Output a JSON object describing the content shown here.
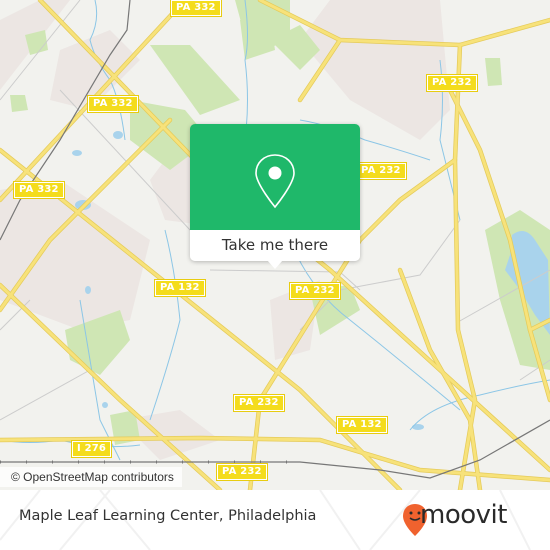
{
  "map": {
    "attribution": "© OpenStreetMap contributors",
    "road_shields": [
      {
        "id": "pa332-top",
        "label": "PA 332"
      },
      {
        "id": "pa332-mid",
        "label": "PA 332"
      },
      {
        "id": "pa332-left",
        "label": "PA 332"
      },
      {
        "id": "pa232-ne",
        "label": "PA 232"
      },
      {
        "id": "pa232-e",
        "label": "PA 232"
      },
      {
        "id": "pa232-center",
        "label": "PA 232"
      },
      {
        "id": "pa132-w",
        "label": "PA 132"
      },
      {
        "id": "pa232-s",
        "label": "PA 232"
      },
      {
        "id": "pa132-se",
        "label": "PA 132"
      },
      {
        "id": "i276",
        "label": "I 276"
      },
      {
        "id": "pa232-bottom",
        "label": "PA 232"
      }
    ],
    "colors": {
      "land": "#f2f2ee",
      "road": "#f7e27a",
      "road_outline": "#e5cb5a",
      "park": "#cfe6b4",
      "urban": "#ece6e3",
      "water": "#a9d3ec",
      "rail": "#777777"
    }
  },
  "popup": {
    "action_label": "Take me there",
    "icon": "map-pin-icon",
    "color": "#1fb86a"
  },
  "footer": {
    "place_name": "Maple Leaf Learning Center, Philadelphia",
    "brand": "moovit",
    "brand_color": "#f0622e"
  }
}
